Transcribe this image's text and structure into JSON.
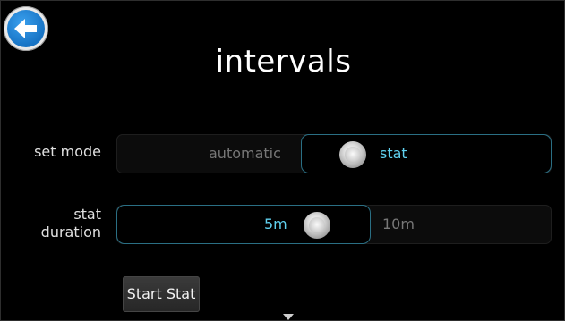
{
  "header": {
    "title": "intervals",
    "back_icon": "back-arrow-icon",
    "accent": "#1773c4"
  },
  "set_mode": {
    "label": "set mode",
    "options": [
      "automatic",
      "stat"
    ],
    "selected": "stat"
  },
  "stat_duration": {
    "label_line1": "stat",
    "label_line2": "duration",
    "options": [
      "5m",
      "10m"
    ],
    "selected": "5m"
  },
  "actions": {
    "start_stat": "Start Stat"
  },
  "colors": {
    "selected_text": "#5fd0ee",
    "unselected_text": "#777777",
    "active_border": "#2a6f84"
  }
}
